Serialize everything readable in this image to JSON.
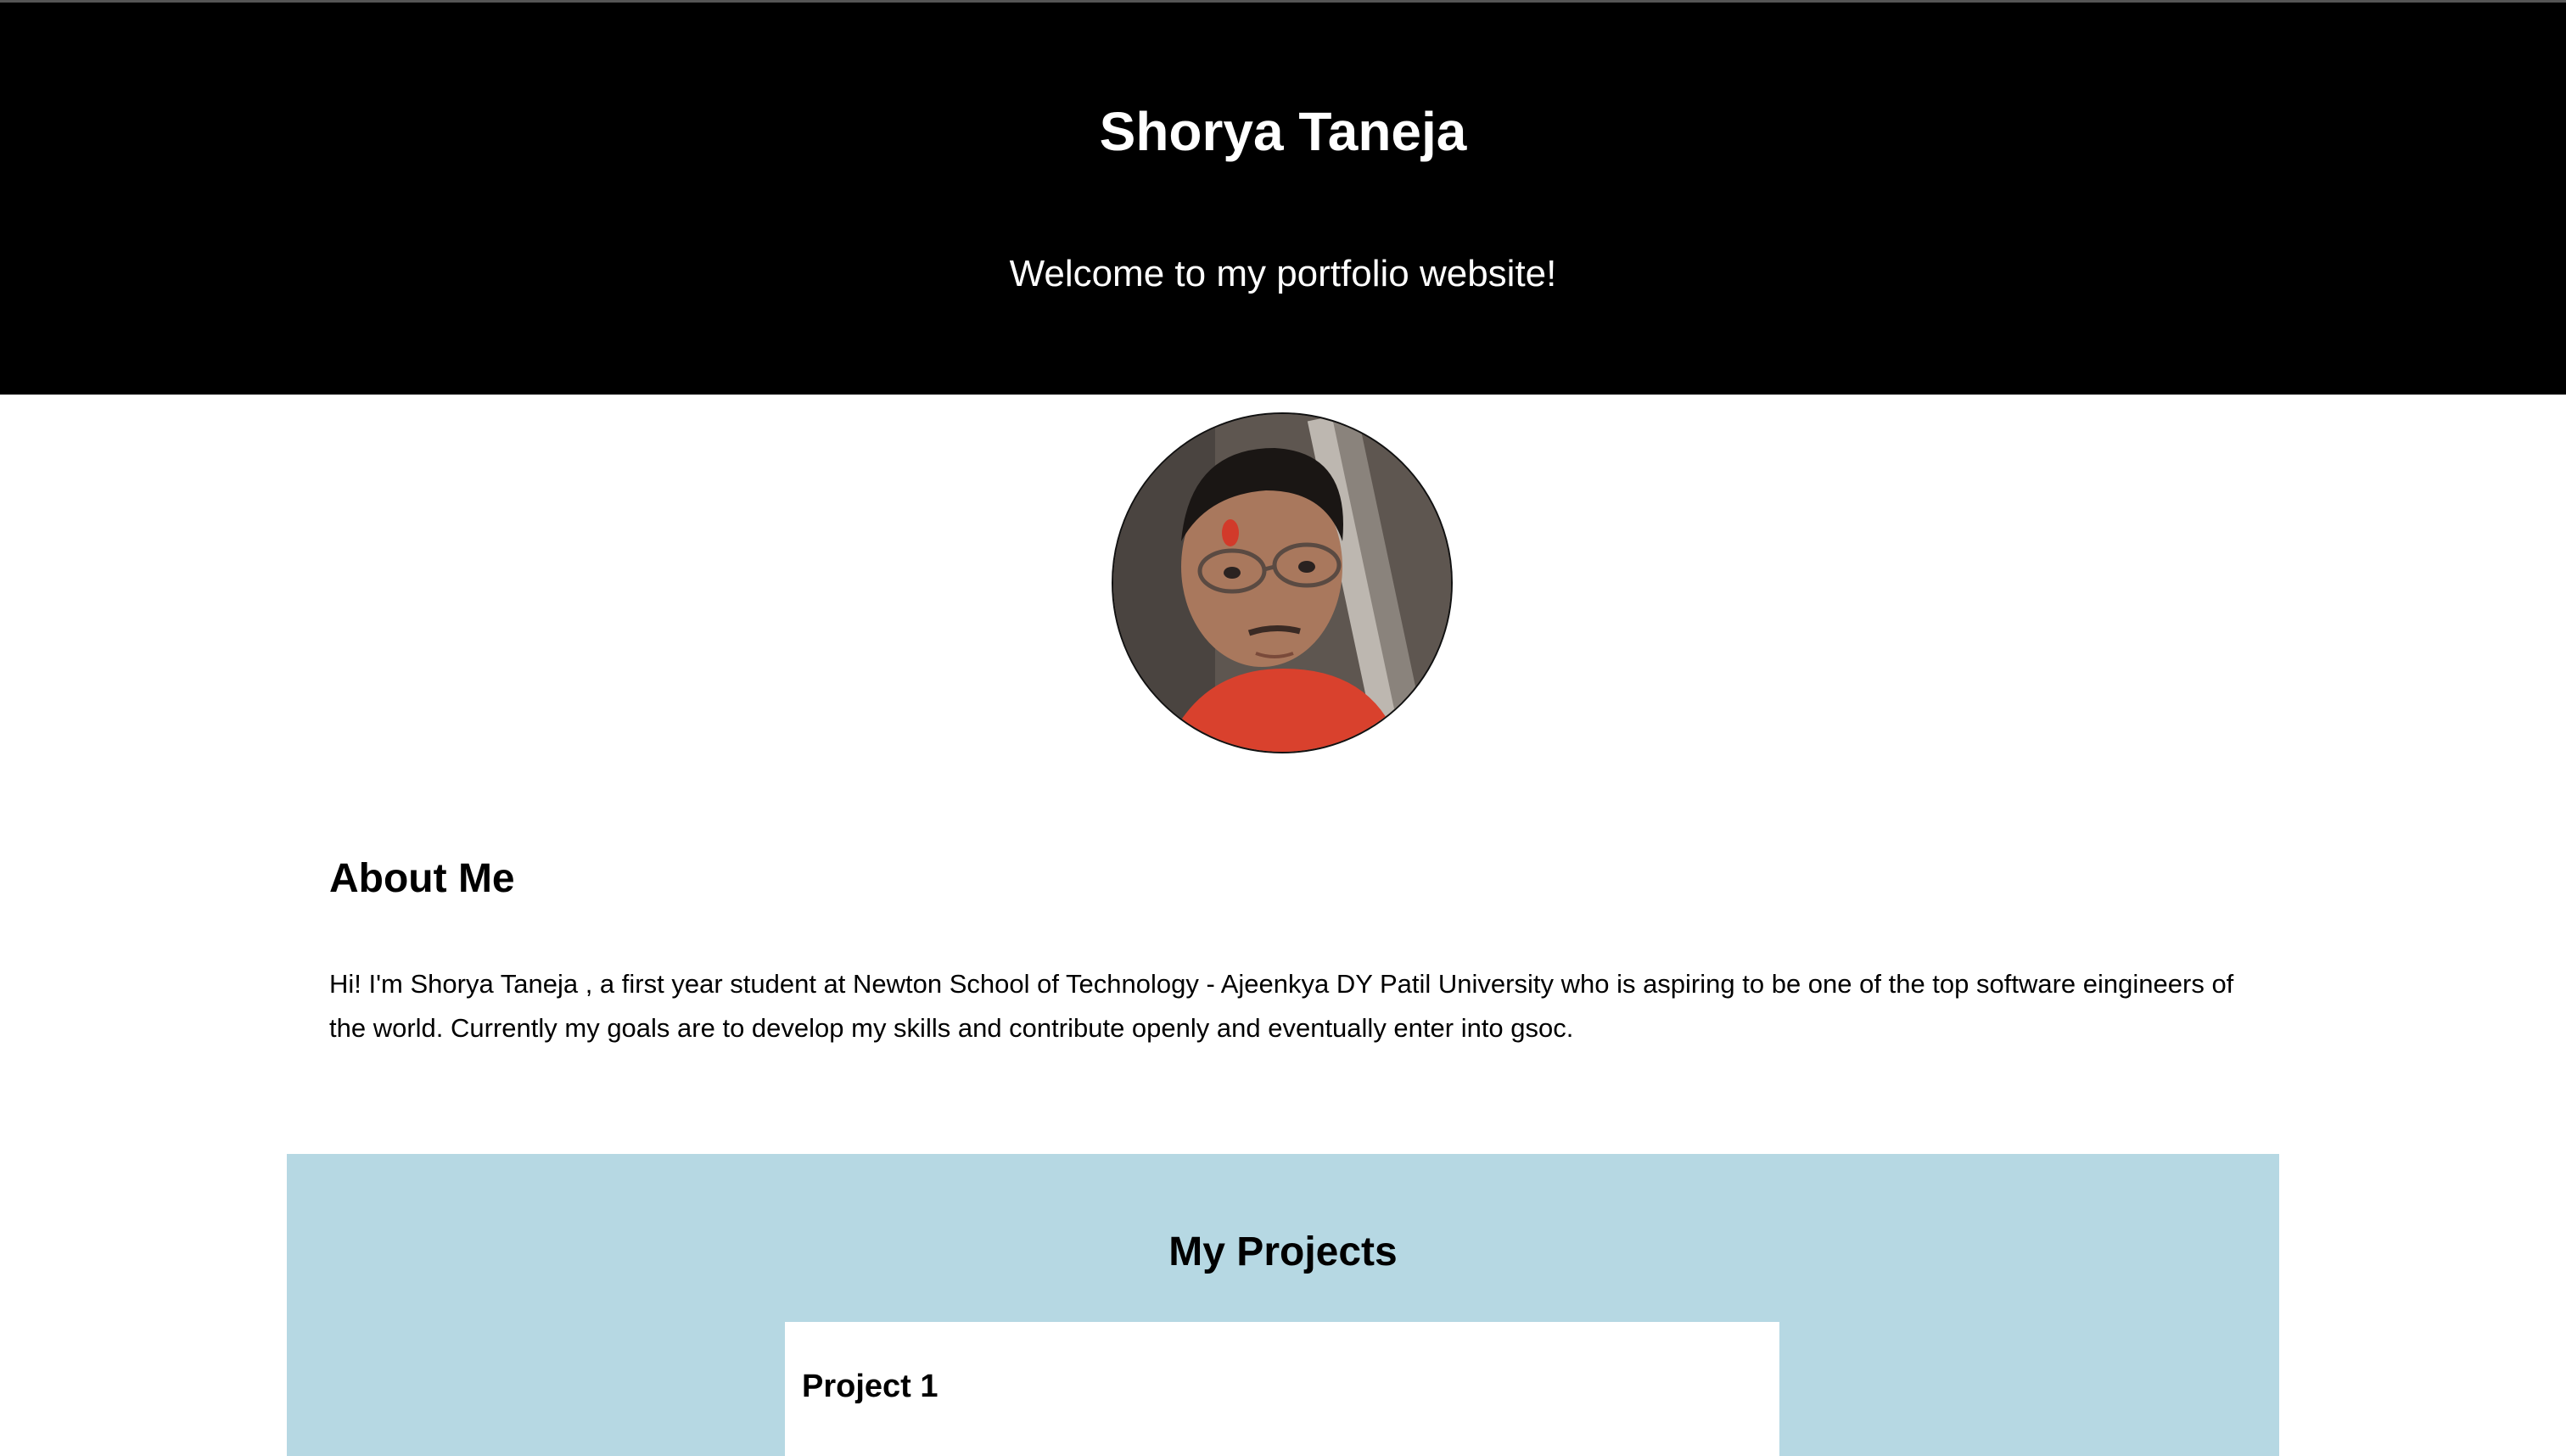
{
  "header": {
    "title": "Shorya Taneja",
    "subtitle": "Welcome to my portfolio website!"
  },
  "profile": {
    "image_icon": "profile-photo"
  },
  "about": {
    "heading": "About Me",
    "text": "Hi! I'm Shorya Taneja , a first year student at Newton School of Technology - Ajeenkya DY Patil University who is aspiring to be one of the top software eingineers of the world. Currently my goals are to develop my skills and contribute openly and eventually enter into gsoc."
  },
  "projects": {
    "heading": "My Projects",
    "items": [
      {
        "title": "Project 1"
      }
    ]
  },
  "colors": {
    "header_bg": "#000000",
    "header_text": "#ffffff",
    "projects_bg": "#b6d8e3",
    "card_bg": "#ffffff"
  }
}
